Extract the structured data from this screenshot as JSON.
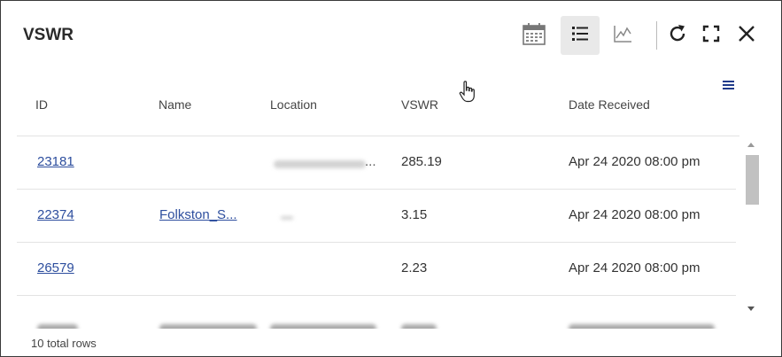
{
  "widget": {
    "title": "VSWR"
  },
  "toolbar": {
    "buttons": [
      {
        "name": "calendar-icon",
        "active": false
      },
      {
        "name": "list-view-icon",
        "active": true
      },
      {
        "name": "chart-view-icon",
        "active": false
      },
      {
        "name": "refresh-icon",
        "active": false
      },
      {
        "name": "expand-icon",
        "active": false
      },
      {
        "name": "close-icon",
        "active": false
      }
    ]
  },
  "table": {
    "columns": [
      "ID",
      "Name",
      "Location",
      "VSWR",
      "Date Received"
    ],
    "rows": [
      {
        "id": "23181",
        "name": "",
        "location_suffix": "...",
        "vswr": "285.19",
        "date": "Apr 24 2020 08:00 pm"
      },
      {
        "id": "22374",
        "name": "Folkston_S...",
        "location_suffix": "",
        "vswr": "3.15",
        "date": "Apr 24 2020 08:00 pm"
      },
      {
        "id": "26579",
        "name": "",
        "location_suffix": "",
        "vswr": "2.23",
        "date": "Apr 24 2020 08:00 pm"
      }
    ]
  },
  "footer": {
    "total_rows": "10 total rows"
  },
  "colors": {
    "link": "#2d4e9e",
    "accent": "#1f3a8a",
    "border": "#3a3a3a"
  }
}
